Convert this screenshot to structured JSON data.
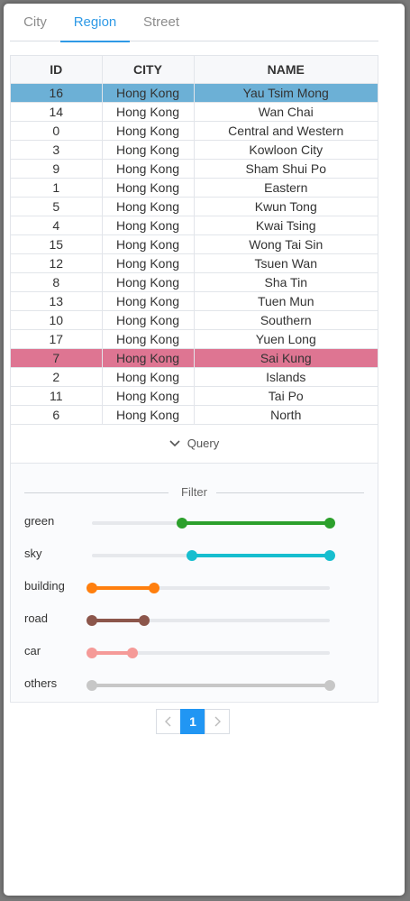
{
  "tabs": [
    {
      "label": "City",
      "active": false
    },
    {
      "label": "Region",
      "active": true
    },
    {
      "label": "Street",
      "active": false
    }
  ],
  "table": {
    "columns": [
      "ID",
      "CITY",
      "NAME"
    ],
    "rows": [
      {
        "id": "16",
        "city": "Hong Kong",
        "name": "Yau Tsim Mong",
        "highlight": "blue"
      },
      {
        "id": "14",
        "city": "Hong Kong",
        "name": "Wan Chai"
      },
      {
        "id": "0",
        "city": "Hong Kong",
        "name": "Central and Western"
      },
      {
        "id": "3",
        "city": "Hong Kong",
        "name": "Kowloon City"
      },
      {
        "id": "9",
        "city": "Hong Kong",
        "name": "Sham Shui Po"
      },
      {
        "id": "1",
        "city": "Hong Kong",
        "name": "Eastern"
      },
      {
        "id": "5",
        "city": "Hong Kong",
        "name": "Kwun Tong"
      },
      {
        "id": "4",
        "city": "Hong Kong",
        "name": "Kwai Tsing"
      },
      {
        "id": "15",
        "city": "Hong Kong",
        "name": "Wong Tai Sin"
      },
      {
        "id": "12",
        "city": "Hong Kong",
        "name": "Tsuen Wan"
      },
      {
        "id": "8",
        "city": "Hong Kong",
        "name": "Sha Tin"
      },
      {
        "id": "13",
        "city": "Hong Kong",
        "name": "Tuen Mun"
      },
      {
        "id": "10",
        "city": "Hong Kong",
        "name": "Southern"
      },
      {
        "id": "17",
        "city": "Hong Kong",
        "name": "Yuen Long"
      },
      {
        "id": "7",
        "city": "Hong Kong",
        "name": "Sai Kung",
        "highlight": "pink"
      },
      {
        "id": "2",
        "city": "Hong Kong",
        "name": "Islands"
      },
      {
        "id": "11",
        "city": "Hong Kong",
        "name": "Tai Po"
      },
      {
        "id": "6",
        "city": "Hong Kong",
        "name": "North"
      }
    ]
  },
  "query": {
    "label": "Query",
    "icon": "chevron-down-icon"
  },
  "filter": {
    "title": "Filter",
    "sliders": [
      {
        "label": "green",
        "color": "#2ca02c",
        "range": [
          0.38,
          1.0
        ]
      },
      {
        "label": "sky",
        "color": "#17becf",
        "range": [
          0.42,
          1.0
        ]
      },
      {
        "label": "building",
        "color": "#ff7f0e",
        "range": [
          0.0,
          0.26
        ]
      },
      {
        "label": "road",
        "color": "#8c564b",
        "range": [
          0.0,
          0.22
        ]
      },
      {
        "label": "car",
        "color": "#f59a98",
        "range": [
          0.0,
          0.17
        ]
      },
      {
        "label": "others",
        "color": "#c7c7c7",
        "range": [
          0.0,
          1.0
        ]
      }
    ]
  },
  "pagination": {
    "prev_icon": "chevron-left-icon",
    "current": "1",
    "next_icon": "chevron-right-icon"
  }
}
